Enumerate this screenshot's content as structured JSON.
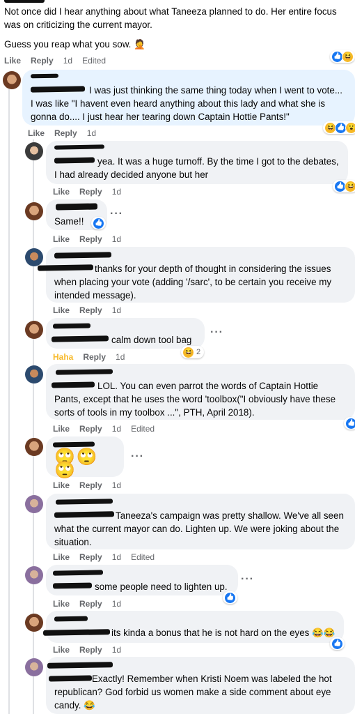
{
  "top": {
    "text1": "Not once did I hear anything about what Taneeza planned to do. Her entire focus was on criticizing the current mayor.",
    "text2": "Guess you reap what you sow. 🤦",
    "like": "Like",
    "reply": "Reply",
    "time": "1d",
    "edited": "Edited"
  },
  "comments": [
    {
      "text": "I was just thinking the same thing today when I went to vote... I was like \"I havent even heard anything about this lady and what she is gonna do.... I just hear her tearing down Captain Hottie Pants!\"",
      "like": "Like",
      "reply": "Reply",
      "time": "1d"
    },
    {
      "text": "yea. It was a huge turnoff. By the time I got to the debates, I had already decided anyone but her",
      "like": "Like",
      "reply": "Reply",
      "time": "1d"
    },
    {
      "text": "Same!!",
      "like": "Like",
      "reply": "Reply",
      "time": "1d"
    },
    {
      "text": "thanks for your depth of thought in considering the issues when placing your vote (adding '/sarc', to be certain you receive my intended message).",
      "like": "Like",
      "reply": "Reply",
      "time": "1d"
    },
    {
      "text": "calm down tool bag",
      "like": "Haha",
      "reply": "Reply",
      "time": "1d",
      "reaction_count": "2"
    },
    {
      "text": "LOL. You can even parrot the words of Captain Hottie Pants, except that he uses the word 'toolbox(\"I obviously have these sorts of tools in my toolbox ...\", PTH, April 2018).",
      "like": "Like",
      "reply": "Reply",
      "time": "1d",
      "edited": "Edited"
    },
    {
      "text": "🙄🙄🙄",
      "like": "Like",
      "reply": "Reply",
      "time": "1d"
    },
    {
      "text": "Taneeza's campaign was pretty shallow. We've all seen what the current mayor can do. Lighten up. We were joking about the situation.",
      "like": "Like",
      "reply": "Reply",
      "time": "1d",
      "edited": "Edited"
    },
    {
      "text": "some people need to lighten up.",
      "like": "Like",
      "reply": "Reply",
      "time": "1d"
    },
    {
      "text": "its kinda a bonus that he is not hard on the eyes 😂😂",
      "like": "Like",
      "reply": "Reply",
      "time": "1d"
    },
    {
      "text": "Exactly! Remember when Kristi Noem was labeled the hot republican? God forbid us women make a side comment about eye candy. 😂"
    }
  ],
  "icons": {
    "like": "like-reaction-icon",
    "haha": "haha-reaction-icon",
    "wow": "wow-reaction-icon",
    "more": "more-options-icon"
  },
  "colors": {
    "bubble": "#f0f2f5",
    "bubble_selected": "#e7f3ff",
    "meta": "#65676b",
    "like_blue": "#1877f2",
    "haha_yellow": "#f7b928"
  }
}
